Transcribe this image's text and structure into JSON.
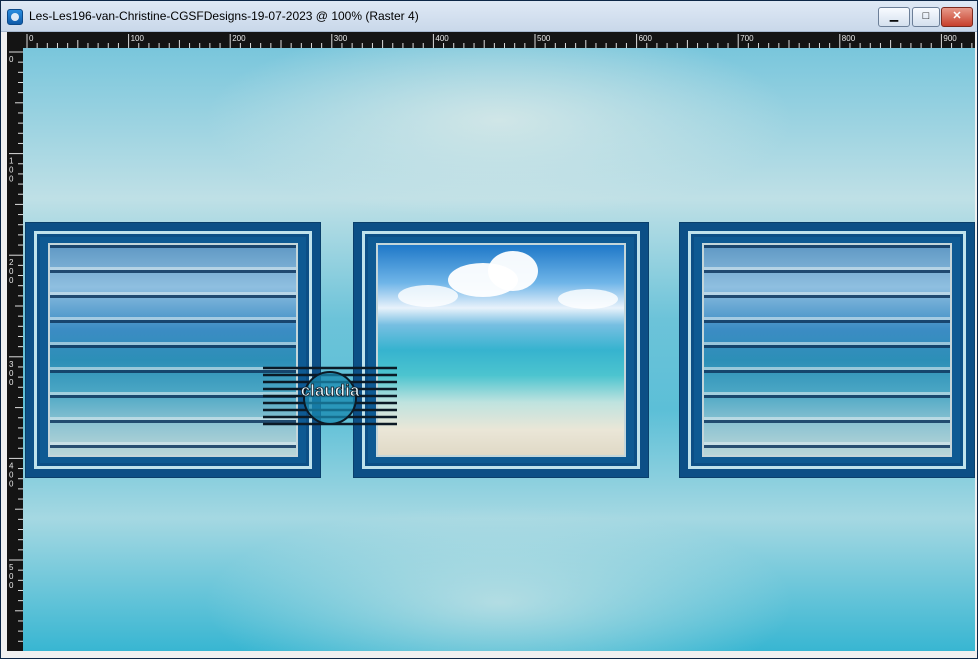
{
  "window": {
    "title": "Les-Les196-van-Christine-CGSFDesigns-19-07-2023 @ 100% (Raster 4)",
    "buttons": {
      "minimize": "▁",
      "maximize": "□",
      "close": "✕"
    }
  },
  "rulers": {
    "horizontal_labels": [
      "0",
      "100",
      "200",
      "300",
      "400",
      "500",
      "600",
      "700",
      "800",
      "900"
    ],
    "vertical_labels": [
      "0",
      "100",
      "200",
      "300",
      "400",
      "500"
    ]
  },
  "canvas": {
    "watermark_text": "claudia"
  }
}
